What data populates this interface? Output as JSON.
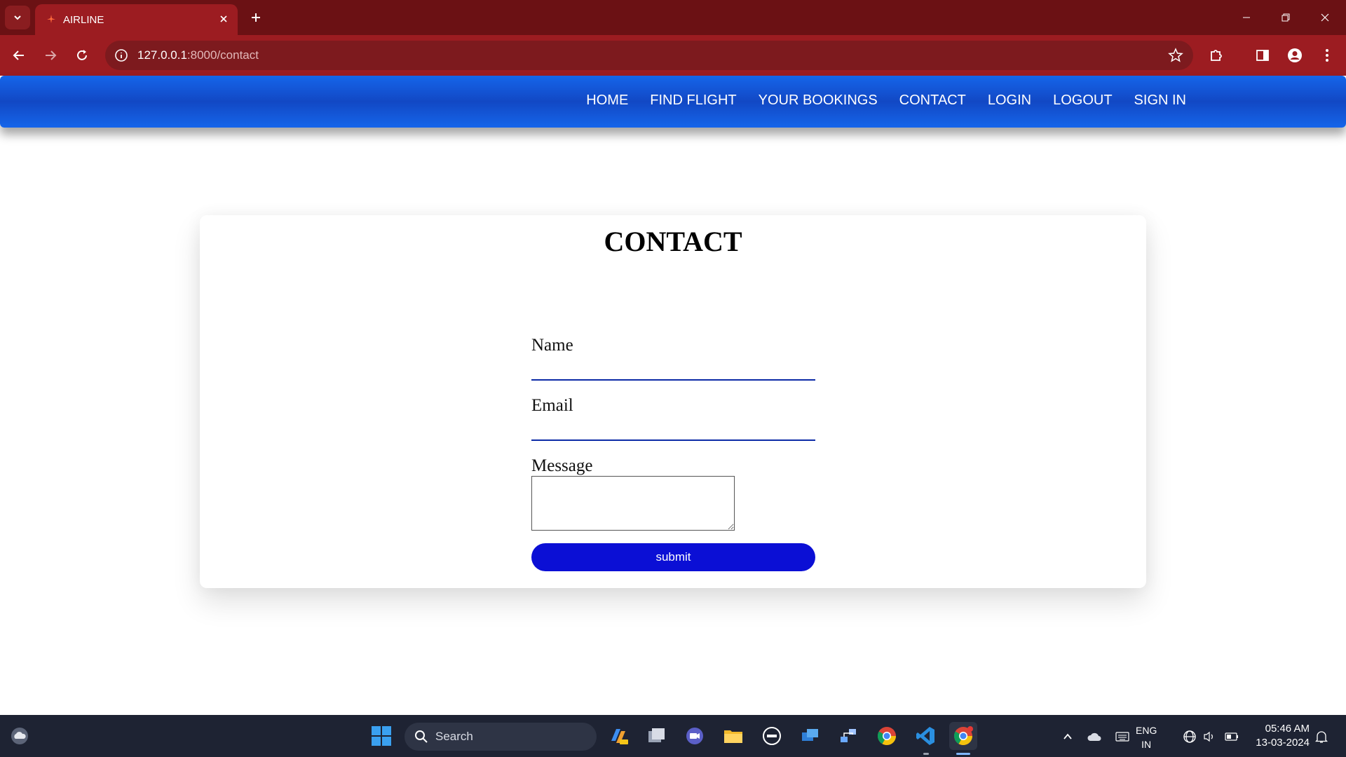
{
  "browser": {
    "tab_title": "AIRLINE",
    "url_host": "127.0.0.1",
    "url_rest": ":8000/contact"
  },
  "nav": {
    "items": [
      {
        "label": "HOME"
      },
      {
        "label": "FIND FLIGHT"
      },
      {
        "label": "YOUR BOOKINGS"
      },
      {
        "label": "CONTACT"
      },
      {
        "label": "LOGIN"
      },
      {
        "label": "LOGOUT"
      },
      {
        "label": "SIGN IN"
      }
    ]
  },
  "contact": {
    "title": "CONTACT",
    "name_label": "Name",
    "name_value": "",
    "email_label": "Email",
    "email_value": "",
    "message_label": "Message",
    "message_value": "",
    "submit_label": "submit"
  },
  "taskbar": {
    "search_placeholder": "Search",
    "lang_line1": "ENG",
    "lang_line2": "IN",
    "time": "05:46 AM",
    "date": "13-03-2024"
  },
  "colors": {
    "tabbar": "#6b1114",
    "toolbar": "#9c1c21",
    "nav_blue": "#1565ea",
    "submit_blue": "#0b0fd5",
    "taskbar": "#1e2333"
  }
}
